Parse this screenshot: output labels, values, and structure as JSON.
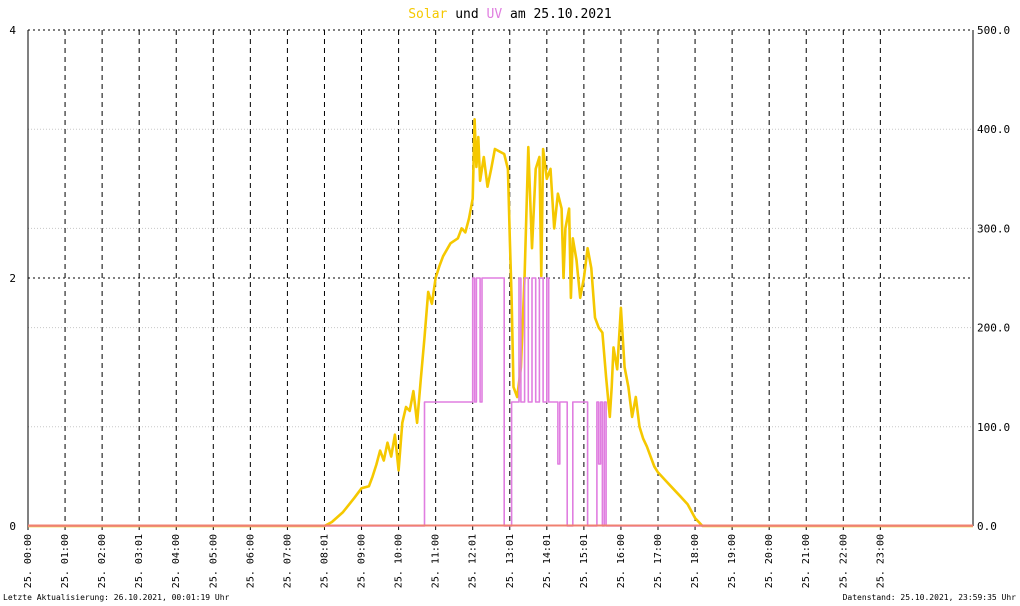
{
  "title": {
    "part1": "Solar",
    "part2": " und ",
    "part3": "UV",
    "part4": " am 25.10.2021"
  },
  "footer": {
    "left": "Letzte Aktualisierung: 26.10.2021, 00:01:19 Uhr",
    "right": "Datenstand: 25.10.2021, 23:59:35 Uhr"
  },
  "colors": {
    "solar": "#f5c800",
    "uv": "#e07ee0",
    "baseline": "#f08070",
    "grid": "#000000",
    "minor_grid": "#c8c8c8",
    "title_default": "#000000"
  },
  "chart_data": {
    "type": "line",
    "x_unit": "hour of day",
    "xlim": [
      0,
      25.5
    ],
    "x_ticks": [
      {
        "x": 0,
        "label": "25. 00:00"
      },
      {
        "x": 1,
        "label": "25. 01:00"
      },
      {
        "x": 2,
        "label": "25. 02:00"
      },
      {
        "x": 3,
        "label": "25. 03:01"
      },
      {
        "x": 4,
        "label": "25. 04:00"
      },
      {
        "x": 5,
        "label": "25. 05:00"
      },
      {
        "x": 6,
        "label": "25. 06:00"
      },
      {
        "x": 7,
        "label": "25. 07:00"
      },
      {
        "x": 8,
        "label": "25. 08:01"
      },
      {
        "x": 9,
        "label": "25. 09:00"
      },
      {
        "x": 10,
        "label": "25. 10:00"
      },
      {
        "x": 11,
        "label": "25. 11:00"
      },
      {
        "x": 12,
        "label": "25. 12:01"
      },
      {
        "x": 13,
        "label": "25. 13:01"
      },
      {
        "x": 14,
        "label": "25. 14:01"
      },
      {
        "x": 15,
        "label": "25. 15:01"
      },
      {
        "x": 16,
        "label": "25. 16:00"
      },
      {
        "x": 17,
        "label": "25. 17:00"
      },
      {
        "x": 18,
        "label": "25. 18:00"
      },
      {
        "x": 19,
        "label": "25. 19:00"
      },
      {
        "x": 20,
        "label": "25. 20:00"
      },
      {
        "x": 21,
        "label": "25. 21:00"
      },
      {
        "x": 22,
        "label": "25. 22:00"
      },
      {
        "x": 23,
        "label": "25. 23:00"
      }
    ],
    "y_left": {
      "lim": [
        0,
        4
      ],
      "ticks": [
        0,
        2,
        4
      ],
      "labels": [
        "0",
        "2",
        "4"
      ]
    },
    "y_right": {
      "lim": [
        0,
        500
      ],
      "ticks": [
        0,
        100,
        200,
        300,
        400,
        500
      ],
      "labels": [
        "0.0",
        "100.0",
        "200.0",
        "300.0",
        "400.0",
        "500.0"
      ]
    },
    "grid": true,
    "series": [
      {
        "name": "Solar",
        "axis": "right",
        "points": [
          [
            0,
            0
          ],
          [
            8.0,
            0
          ],
          [
            8.2,
            4
          ],
          [
            8.5,
            14
          ],
          [
            8.8,
            28
          ],
          [
            9.0,
            38
          ],
          [
            9.2,
            40
          ],
          [
            9.3,
            50
          ],
          [
            9.4,
            62
          ],
          [
            9.5,
            76
          ],
          [
            9.6,
            66
          ],
          [
            9.7,
            84
          ],
          [
            9.8,
            70
          ],
          [
            9.9,
            92
          ],
          [
            10.0,
            56
          ],
          [
            10.1,
            104
          ],
          [
            10.2,
            120
          ],
          [
            10.3,
            116
          ],
          [
            10.4,
            136
          ],
          [
            10.5,
            104
          ],
          [
            10.6,
            148
          ],
          [
            10.7,
            190
          ],
          [
            10.8,
            236
          ],
          [
            10.9,
            224
          ],
          [
            11.0,
            250
          ],
          [
            11.1,
            262
          ],
          [
            11.2,
            272
          ],
          [
            11.4,
            285
          ],
          [
            11.6,
            290
          ],
          [
            11.7,
            300
          ],
          [
            11.8,
            296
          ],
          [
            11.9,
            310
          ],
          [
            12.0,
            330
          ],
          [
            12.05,
            410
          ],
          [
            12.1,
            362
          ],
          [
            12.15,
            392
          ],
          [
            12.2,
            348
          ],
          [
            12.3,
            372
          ],
          [
            12.4,
            342
          ],
          [
            12.5,
            360
          ],
          [
            12.6,
            380
          ],
          [
            12.7,
            378
          ],
          [
            12.85,
            375
          ],
          [
            12.95,
            360
          ],
          [
            13.0,
            290
          ],
          [
            13.05,
            230
          ],
          [
            13.1,
            140
          ],
          [
            13.2,
            130
          ],
          [
            13.3,
            160
          ],
          [
            13.4,
            252
          ],
          [
            13.5,
            382
          ],
          [
            13.6,
            280
          ],
          [
            13.7,
            360
          ],
          [
            13.8,
            372
          ],
          [
            13.85,
            252
          ],
          [
            13.9,
            380
          ],
          [
            14.0,
            350
          ],
          [
            14.1,
            360
          ],
          [
            14.2,
            300
          ],
          [
            14.3,
            335
          ],
          [
            14.4,
            320
          ],
          [
            14.45,
            250
          ],
          [
            14.5,
            300
          ],
          [
            14.6,
            320
          ],
          [
            14.65,
            230
          ],
          [
            14.7,
            290
          ],
          [
            14.8,
            268
          ],
          [
            14.9,
            230
          ],
          [
            15.0,
            250
          ],
          [
            15.1,
            280
          ],
          [
            15.2,
            260
          ],
          [
            15.3,
            210
          ],
          [
            15.4,
            200
          ],
          [
            15.5,
            195
          ],
          [
            15.6,
            150
          ],
          [
            15.7,
            110
          ],
          [
            15.75,
            140
          ],
          [
            15.8,
            180
          ],
          [
            15.9,
            158
          ],
          [
            16.0,
            220
          ],
          [
            16.1,
            160
          ],
          [
            16.2,
            140
          ],
          [
            16.3,
            110
          ],
          [
            16.4,
            130
          ],
          [
            16.5,
            100
          ],
          [
            16.6,
            88
          ],
          [
            16.7,
            80
          ],
          [
            16.8,
            70
          ],
          [
            16.9,
            60
          ],
          [
            17.0,
            54
          ],
          [
            17.2,
            46
          ],
          [
            17.4,
            38
          ],
          [
            17.6,
            30
          ],
          [
            17.8,
            22
          ],
          [
            18.0,
            8
          ],
          [
            18.2,
            0
          ],
          [
            25.5,
            0
          ]
        ]
      },
      {
        "name": "UV",
        "axis": "left",
        "points": [
          [
            0,
            0
          ],
          [
            10.7,
            0
          ],
          [
            10.7,
            1
          ],
          [
            12.0,
            1
          ],
          [
            12.0,
            2
          ],
          [
            12.05,
            2
          ],
          [
            12.05,
            1
          ],
          [
            12.1,
            1
          ],
          [
            12.1,
            2
          ],
          [
            12.2,
            2
          ],
          [
            12.2,
            1
          ],
          [
            12.25,
            1
          ],
          [
            12.25,
            2
          ],
          [
            12.4,
            2
          ],
          [
            12.4,
            2
          ],
          [
            12.85,
            2
          ],
          [
            12.85,
            0
          ],
          [
            13.05,
            0
          ],
          [
            13.05,
            1
          ],
          [
            13.25,
            1
          ],
          [
            13.25,
            2
          ],
          [
            13.3,
            2
          ],
          [
            13.3,
            1
          ],
          [
            13.4,
            1
          ],
          [
            13.4,
            2
          ],
          [
            13.5,
            2
          ],
          [
            13.5,
            1
          ],
          [
            13.6,
            1
          ],
          [
            13.6,
            2
          ],
          [
            13.7,
            2
          ],
          [
            13.7,
            1
          ],
          [
            13.8,
            1
          ],
          [
            13.8,
            2
          ],
          [
            13.9,
            2
          ],
          [
            13.9,
            1
          ],
          [
            14.0,
            1
          ],
          [
            14.0,
            2
          ],
          [
            14.05,
            2
          ],
          [
            14.05,
            1
          ],
          [
            14.3,
            1
          ],
          [
            14.3,
            0.5
          ],
          [
            14.35,
            0.5
          ],
          [
            14.35,
            1
          ],
          [
            14.55,
            1
          ],
          [
            14.55,
            0
          ],
          [
            14.7,
            0
          ],
          [
            14.7,
            1
          ],
          [
            15.1,
            1
          ],
          [
            15.1,
            0
          ],
          [
            15.35,
            0
          ],
          [
            15.35,
            1
          ],
          [
            15.4,
            1
          ],
          [
            15.4,
            0.5
          ],
          [
            15.45,
            0.5
          ],
          [
            15.45,
            1
          ],
          [
            15.5,
            1
          ],
          [
            15.5,
            0
          ],
          [
            15.55,
            0
          ],
          [
            15.55,
            1
          ],
          [
            15.6,
            1
          ],
          [
            15.6,
            0
          ],
          [
            18.0,
            0
          ],
          [
            25.5,
            0
          ]
        ]
      }
    ]
  }
}
